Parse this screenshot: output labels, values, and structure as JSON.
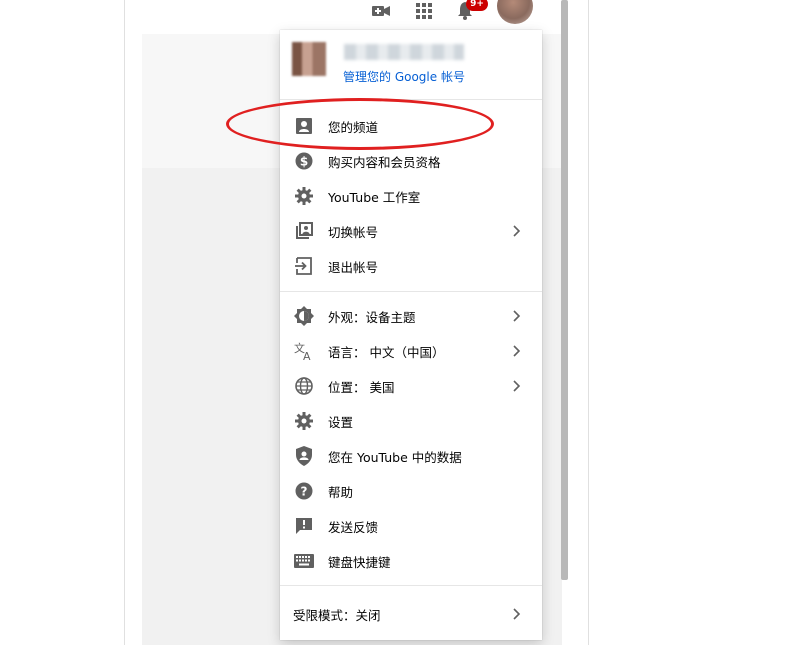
{
  "topbar": {
    "create_icon": "video-camera-plus-icon",
    "apps_icon": "apps-grid-icon",
    "notifications_icon": "bell-icon",
    "notification_badge": "9+"
  },
  "account_menu": {
    "header": {
      "manage_account": "管理您的 Google 帐号"
    },
    "section_1": [
      {
        "label": "您的频道",
        "icon": "account-box-icon",
        "chevron": false
      },
      {
        "label": "购买内容和会员资格",
        "icon": "dollar-circle-icon",
        "chevron": false
      },
      {
        "label": "YouTube 工作室",
        "icon": "gear-icon",
        "chevron": false
      },
      {
        "label": "切换帐号",
        "icon": "switch-account-icon",
        "chevron": true
      },
      {
        "label": "退出帐号",
        "icon": "sign-out-icon",
        "chevron": false
      }
    ],
    "section_2": [
      {
        "label": "外观：设备主题",
        "icon": "appearance-icon",
        "chevron": true
      },
      {
        "label": "语言： 中文（中国）",
        "icon": "translate-icon",
        "chevron": true
      },
      {
        "label": "位置： 美国",
        "icon": "globe-icon",
        "chevron": true
      },
      {
        "label": "设置",
        "icon": "gear-icon",
        "chevron": false
      },
      {
        "label": "您在 YouTube 中的数据",
        "icon": "shield-user-icon",
        "chevron": false
      },
      {
        "label": "帮助",
        "icon": "help-circle-icon",
        "chevron": false
      },
      {
        "label": "发送反馈",
        "icon": "feedback-icon",
        "chevron": false
      },
      {
        "label": "键盘快捷键",
        "icon": "keyboard-icon",
        "chevron": false
      }
    ],
    "restricted_mode": {
      "label": "受限模式：关闭",
      "chevron": true
    }
  },
  "colors": {
    "link_blue": "#065fd4",
    "icon_gray": "#606060",
    "annotation_red": "#e02020",
    "badge_red": "#cc0000"
  }
}
